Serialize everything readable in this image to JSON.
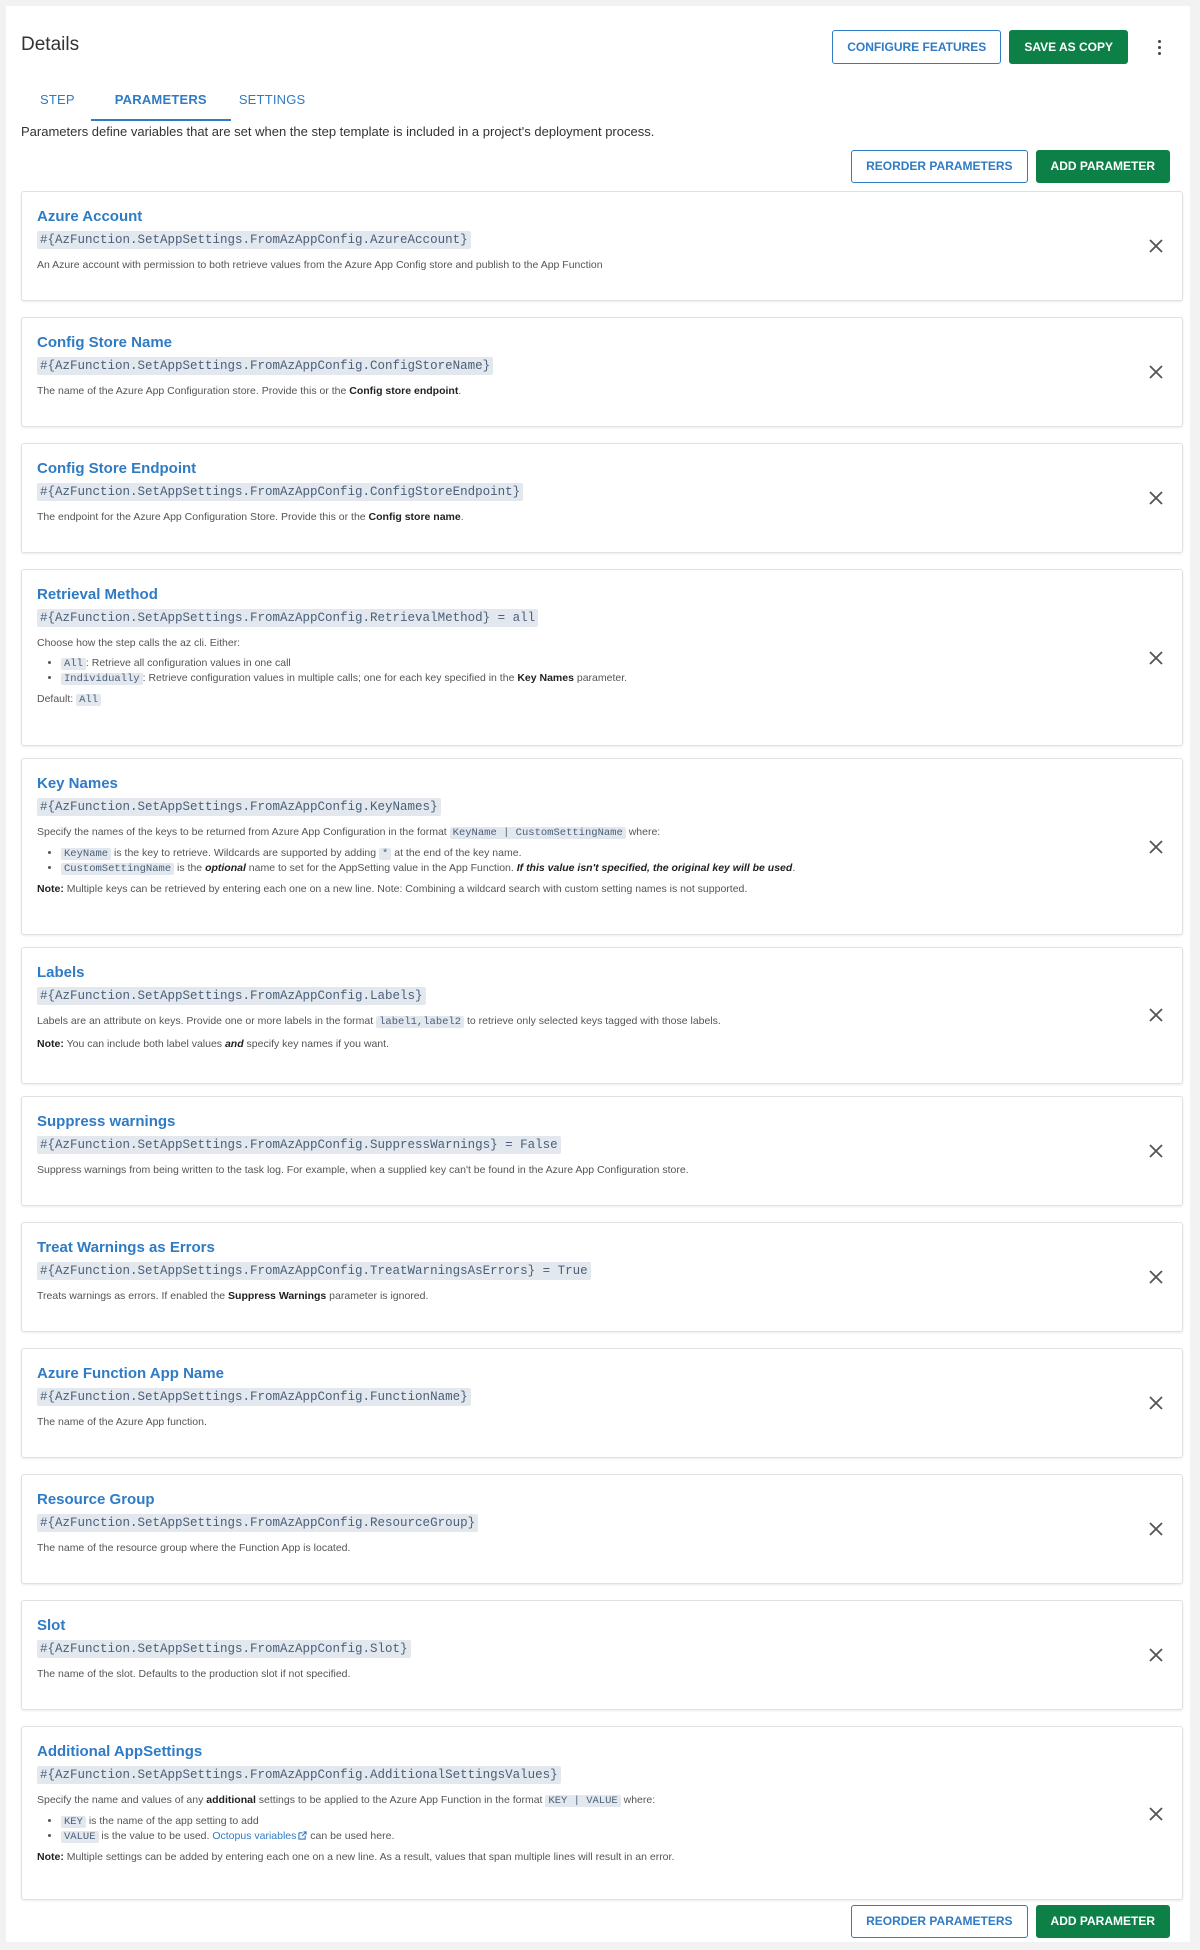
{
  "header": {
    "title": "Details",
    "configure_label": "CONFIGURE FEATURES",
    "save_copy_label": "SAVE AS COPY"
  },
  "tabs": [
    {
      "label": "STEP"
    },
    {
      "label": "PARAMETERS"
    },
    {
      "label": "SETTINGS"
    }
  ],
  "intro": "Parameters define variables that are set when the step template is included in a project's deployment process.",
  "actions": {
    "reorder_label": "REORDER PARAMETERS",
    "add_label": "ADD PARAMETER"
  },
  "parameters": [
    {
      "name": "Azure Account",
      "variable": "#{AzFunction.SetAppSettings.FromAzAppConfig.AzureAccount}",
      "help": "An Azure account with permission to both retrieve values from the Azure App Config store and publish to the App Function"
    },
    {
      "name": "Config Store Name",
      "variable": "#{AzFunction.SetAppSettings.FromAzAppConfig.ConfigStoreName}",
      "help_pre": "The name of the Azure App Configuration store. Provide this or the ",
      "help_bold": "Config store endpoint",
      "help_post": "."
    },
    {
      "name": "Config Store Endpoint",
      "variable": "#{AzFunction.SetAppSettings.FromAzAppConfig.ConfigStoreEndpoint}",
      "help_pre": "The endpoint for the Azure App Configuration Store. Provide this or the ",
      "help_bold": "Config store name",
      "help_post": "."
    },
    {
      "name": "Retrieval Method",
      "variable": "#{AzFunction.SetAppSettings.FromAzAppConfig.RetrievalMethod} = all",
      "help": "Choose how the step calls the az cli. Either:",
      "bullets": [
        {
          "code": "All",
          "text": ": Retrieve all configuration values in one call"
        },
        {
          "code": "Individually",
          "text_pre": ": Retrieve configuration values in multiple calls; one for each key specified in the ",
          "bold": "Key Names",
          "text_post": " parameter."
        }
      ],
      "default_label": "Default: ",
      "default_code": "All"
    },
    {
      "name": "Key Names",
      "variable": "#{AzFunction.SetAppSettings.FromAzAppConfig.KeyNames}",
      "help_pre": "Specify the names of the keys to be returned from Azure App Configuration in the format ",
      "help_code": "KeyName | CustomSettingName",
      "help_post": " where:",
      "bullets": [
        {
          "code": "KeyName",
          "text_pre": " is the key to retrieve. Wildcards are supported by adding ",
          "code2": "*",
          "text_post": " at the end of the key name."
        },
        {
          "code": "CustomSettingName",
          "text_pre": " is the ",
          "italic": "optional",
          "text_mid": " name to set for the AppSetting value in the App Function. ",
          "bold_italic": "If this value isn't specified, the original key will be used",
          "text_post": "."
        }
      ],
      "note_label": "Note:",
      "note": " Multiple keys can be retrieved by entering each one on a new line. Note: Combining a wildcard search with custom setting names is not supported."
    },
    {
      "name": "Labels",
      "variable": "#{AzFunction.SetAppSettings.FromAzAppConfig.Labels}",
      "help_pre": "Labels are an attribute on keys. Provide one or more labels in the format ",
      "help_code": "label1,label2",
      "help_post": " to retrieve only selected keys tagged with those labels.",
      "note_label": "Note:",
      "note_pre": " You can include both label values ",
      "note_bold": "and",
      "note_post": " specify key names if you want."
    },
    {
      "name": "Suppress warnings",
      "variable": "#{AzFunction.SetAppSettings.FromAzAppConfig.SuppressWarnings} = False",
      "help": "Suppress warnings from being written to the task log. For example, when a supplied key can't be found in the Azure App Configuration store."
    },
    {
      "name": "Treat Warnings as Errors",
      "variable": "#{AzFunction.SetAppSettings.FromAzAppConfig.TreatWarningsAsErrors} = True",
      "help_pre": "Treats warnings as errors. If enabled the ",
      "help_bold": "Suppress Warnings",
      "help_post": " parameter is ignored."
    },
    {
      "name": "Azure Function App Name",
      "variable": "#{AzFunction.SetAppSettings.FromAzAppConfig.FunctionName}",
      "help": "The name of the Azure App function."
    },
    {
      "name": "Resource Group",
      "variable": "#{AzFunction.SetAppSettings.FromAzAppConfig.ResourceGroup}",
      "help": "The name of the resource group where the Function App is located."
    },
    {
      "name": "Slot",
      "variable": "#{AzFunction.SetAppSettings.FromAzAppConfig.Slot}",
      "help": "The name of the slot. Defaults to the production slot if not specified."
    },
    {
      "name": "Additional AppSettings",
      "variable": "#{AzFunction.SetAppSettings.FromAzAppConfig.AdditionalSettingsValues}",
      "help_pre": "Specify the name and values of any ",
      "help_bold": "additional",
      "help_mid": " settings to be applied to the Azure App Function in the format ",
      "help_code": "KEY | VALUE",
      "help_post": " where:",
      "bullets": [
        {
          "code": "KEY",
          "text": " is the name of the app setting to add"
        },
        {
          "code": "VALUE",
          "text_pre": " is the value to be used. ",
          "link": "Octopus variables",
          "text_post": " can be used here."
        }
      ],
      "note_label": "Note:",
      "note": " Multiple settings can be added by entering each one on a new line. As a result, values that span multiple lines will result in an error."
    }
  ],
  "colors": {
    "accent": "#2f7bc4",
    "primary_button": "#0d8048",
    "code_bg": "#e3e8ee"
  },
  "icons": [
    "more-vertical-icon",
    "close-icon",
    "external-link-icon"
  ]
}
